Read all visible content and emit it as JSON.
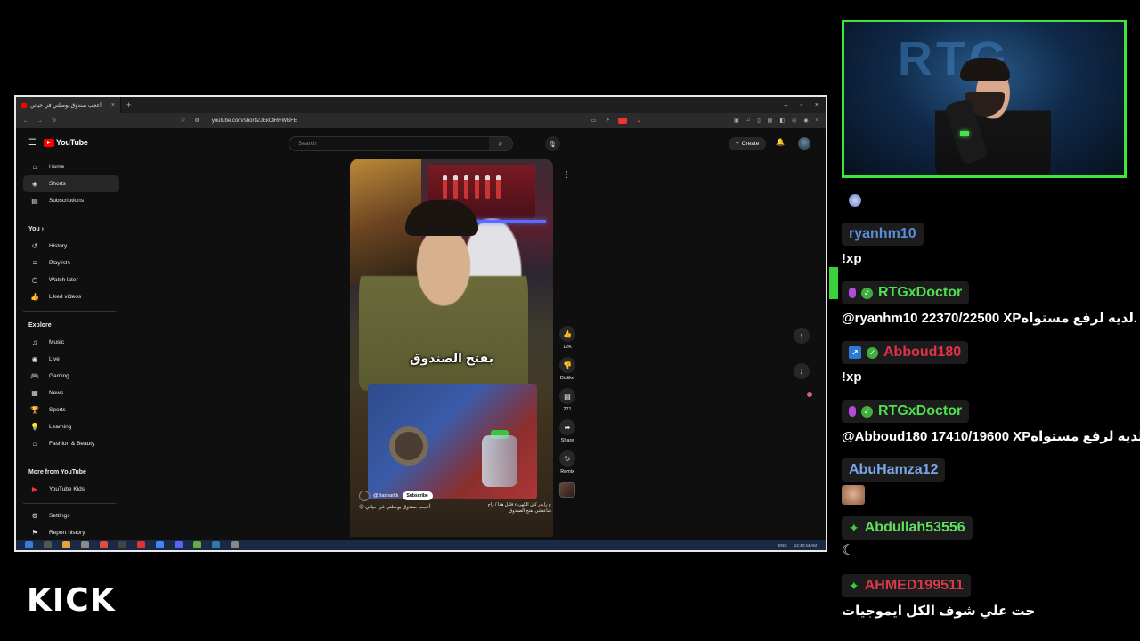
{
  "browser": {
    "tab_title": "أعجب صندوق بوصلني في حياتي",
    "new_tab": "+",
    "url": "youtube.com/shorts/JEkOiRRWBFE",
    "window_controls": [
      "–",
      "▫",
      "×"
    ]
  },
  "youtube": {
    "logo_text": "YouTube",
    "search_placeholder": "Search",
    "create_label": "Create",
    "sidebar": {
      "main": [
        {
          "label": "Home",
          "icon": "home-icon",
          "glyph": "⌂"
        },
        {
          "label": "Shorts",
          "icon": "shorts-icon",
          "glyph": "◈",
          "active": true
        },
        {
          "label": "Subscriptions",
          "icon": "subscriptions-icon",
          "glyph": "▤"
        }
      ],
      "you_title": "You",
      "you": [
        {
          "label": "History",
          "icon": "history-icon",
          "glyph": "↺"
        },
        {
          "label": "Playlists",
          "icon": "playlists-icon",
          "glyph": "≡"
        },
        {
          "label": "Watch later",
          "icon": "clock-icon",
          "glyph": "◷"
        },
        {
          "label": "Liked videos",
          "icon": "thumbs-up-icon",
          "glyph": "👍"
        }
      ],
      "explore_title": "Explore",
      "explore": [
        {
          "label": "Music",
          "icon": "music-icon",
          "glyph": "♫"
        },
        {
          "label": "Live",
          "icon": "live-icon",
          "glyph": "◉"
        },
        {
          "label": "Gaming",
          "icon": "gaming-icon",
          "glyph": "🎮"
        },
        {
          "label": "News",
          "icon": "news-icon",
          "glyph": "▦"
        },
        {
          "label": "Sports",
          "icon": "sports-icon",
          "glyph": "🏆"
        },
        {
          "label": "Learning",
          "icon": "learning-icon",
          "glyph": "💡"
        },
        {
          "label": "Fashion & Beauty",
          "icon": "hanger-icon",
          "glyph": "⌂"
        }
      ],
      "more_title": "More from YouTube",
      "more": [
        {
          "label": "YouTube Kids",
          "icon": "youtube-kids-icon",
          "glyph": "▶"
        }
      ],
      "bottom": [
        {
          "label": "Settings",
          "icon": "settings-icon",
          "glyph": "⚙"
        },
        {
          "label": "Report history",
          "icon": "flag-icon",
          "glyph": "⚑"
        }
      ]
    },
    "short": {
      "caption": "بفتح الصندوق",
      "channel": "@Basharkk",
      "subscribe": "Subscribe",
      "title": "أعجب صندوق بوصلني في حياتي 😮",
      "side_caption": "ج رايدر كيل الكهرباء قللل هذا / راح شاعطني نفتح الصندوق"
    },
    "actions": {
      "like_count": "12K",
      "dislike_label": "Dislike",
      "comment_count": "271",
      "share_label": "Share",
      "remix_label": "Remix"
    },
    "taskbar_lang": "ENG",
    "taskbar_time": "12:40:44 AM"
  },
  "chat": {
    "messages": [
      {
        "user": "ryanhm10",
        "color": "#5b8dd9",
        "text": "!xp"
      },
      {
        "user": "RTGxDoctor",
        "color": "#4ee04e",
        "text": "@ryanhm10 22370/22500 XPلديه لرفع مستواه."
      },
      {
        "user": "Abboud180",
        "color": "#e0334a",
        "text": "!xp"
      },
      {
        "user": "RTGxDoctor",
        "color": "#4ee04e",
        "text": "@Abboud180 17410/19600 XPلديه لرفع مستواه"
      },
      {
        "user": "AbuHamza12",
        "color": "#7aa6e6",
        "text": ""
      },
      {
        "user": "Abdullah53556",
        "color": "#5fe05f",
        "text": ""
      },
      {
        "user": "AHMED199511",
        "color": "#d83a4a",
        "text": "جت علي شوف الكل ايموجيات"
      }
    ]
  },
  "kick_logo": "KICK",
  "webcam_bg_text": "RTG"
}
